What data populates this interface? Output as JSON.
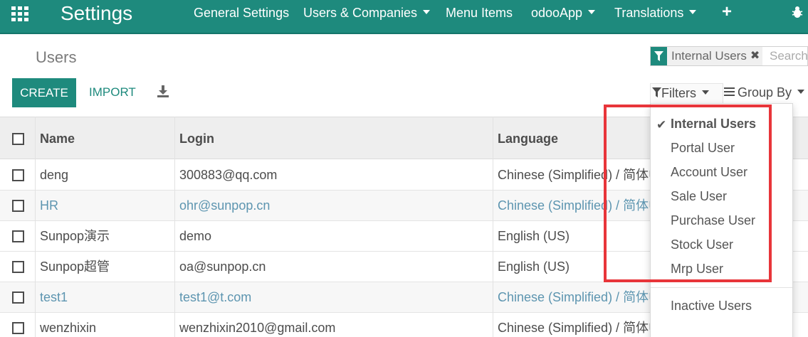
{
  "navbar": {
    "app_title": "Settings",
    "menu": [
      {
        "label": "General Settings",
        "dropdown": false
      },
      {
        "label": "Users & Companies",
        "dropdown": true
      },
      {
        "label": "Menu Items",
        "dropdown": false
      },
      {
        "label": "odooApp",
        "dropdown": true
      },
      {
        "label": "Translations",
        "dropdown": true
      }
    ],
    "plus_icon": "+",
    "icons": [
      "apps-grid-icon",
      "plus-icon",
      "bug-icon"
    ],
    "color": "#1e8a7d"
  },
  "control_panel": {
    "breadcrumb": "Users",
    "search": {
      "facet_label": "Internal Users",
      "facet_close": "✖",
      "placeholder": "Search"
    },
    "create_label": "CREATE",
    "import_label": "IMPORT",
    "filters_label": "Filters",
    "groupby_label": "Group By"
  },
  "table": {
    "columns": [
      "Name",
      "Login",
      "Language"
    ],
    "rows": [
      {
        "name": "deng",
        "login": "300883@qq.com",
        "language": "Chinese (Simplified) / 简体中文",
        "inactive": false
      },
      {
        "name": "HR",
        "login": "ohr@sunpop.cn",
        "language": "Chinese (Simplified) / 简体中文",
        "inactive": true
      },
      {
        "name": "Sunpop演示",
        "login": "demo",
        "language": "English (US)",
        "inactive": false
      },
      {
        "name": "Sunpop超管",
        "login": "oa@sunpop.cn",
        "language": "English (US)",
        "inactive": false
      },
      {
        "name": "test1",
        "login": "test1@t.com",
        "language": "Chinese (Simplified) / 简体中文",
        "inactive": true
      },
      {
        "name": "wenzhixin",
        "login": "wenzhixin2010@gmail.com",
        "language": "Chinese (Simplified) / 简体中文",
        "inactive": false
      }
    ]
  },
  "filters_menu": {
    "check_mark": "✔",
    "items": [
      "Internal Users",
      "Portal User",
      "Account User",
      "Sale User",
      "Purchase User",
      "Stock User",
      "Mrp User"
    ],
    "selected": "Internal Users",
    "extra_items": [
      "Inactive Users"
    ],
    "highlight_color": "#e8353a"
  }
}
